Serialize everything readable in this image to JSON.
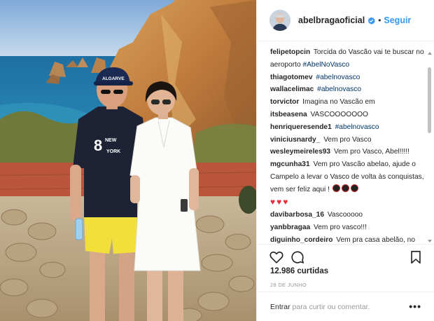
{
  "header": {
    "username": "abelbragaoficial",
    "separator": "•",
    "follow_label": "Seguir"
  },
  "comments": [
    {
      "user": "felipetopcin",
      "text": "Torcida do Vascão vai te buscar no aeroporto ",
      "tag": "#AbelNoVasco"
    },
    {
      "user": "thiagotomev",
      "text": "",
      "tag": "#abelnovasco"
    },
    {
      "user": "wallacelimac",
      "text": "",
      "tag": "#abelnovasco"
    },
    {
      "user": "torvictor",
      "text": "Imagina no Vascão em",
      "tag": ""
    },
    {
      "user": "itsbeasena",
      "text": "VASCOOOOOOO",
      "tag": ""
    },
    {
      "user": "henriqueresende1",
      "text": "",
      "tag": "#abelnovasco"
    },
    {
      "user": "viniciusnardy_",
      "text": " Vem pro Vasco",
      "tag": ""
    },
    {
      "user": "wesleymeireles93",
      "text": "Vem pro Vasco, Abel!!!!!",
      "tag": ""
    },
    {
      "user": "mgcunha31",
      "text": "Vem pro Vascão abelao, ajude o Campelo a levar o Vasco de volta às conquistas, vem ser feliz aqui !",
      "tag": ""
    },
    {
      "user": "davibarbosa_16",
      "text": "Vascooooo",
      "tag": ""
    },
    {
      "user": "yanbbragaa",
      "text": "Vem pro vasco!!!",
      "tag": ""
    },
    {
      "user": "diguinho_cordeiro",
      "text": "Vem pra casa abelão, no Vasco é o seu lugar!!",
      "tag": ""
    }
  ],
  "actions": {
    "like_icon": "heart-outline-icon",
    "comment_icon": "comment-bubble-icon",
    "save_icon": "bookmark-icon"
  },
  "likes": "12.986 curtidas",
  "date": "28 DE JUNHO",
  "add_comment": {
    "login_label": "Entrar",
    "suffix": " para curtir ou comentar.",
    "more_label": "•••"
  },
  "photo": {
    "cap_text": "ALGARVE",
    "shirt_text_top": "NEW",
    "shirt_text_bottom": "YORK",
    "shirt_number": "8"
  },
  "colors": {
    "accent": "#3897f0",
    "verified": "#3897f0",
    "hashtag": "#003569",
    "heart": "#ed2b3b"
  }
}
